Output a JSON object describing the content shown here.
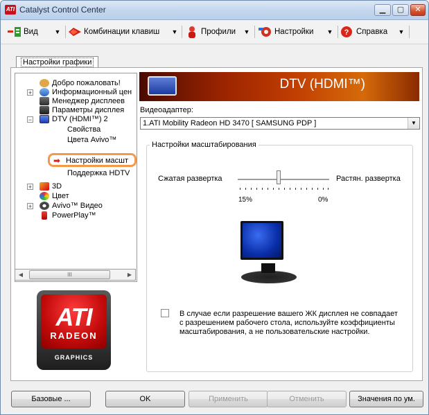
{
  "window": {
    "title": "Catalyst Control Center",
    "icon_text": "ATI"
  },
  "toolbar": {
    "view_label": "Вид",
    "hotkeys_label": "Комбинации клавиш",
    "profiles_label": "Профили",
    "settings_label": "Настройки",
    "help_label": "Справка"
  },
  "tab": {
    "label": "Настройки графики"
  },
  "tree": {
    "items": [
      {
        "label": "Добро пожаловать!"
      },
      {
        "label": "Информационный цен"
      },
      {
        "label": "Менеджер дисплеев"
      },
      {
        "label": "Параметры дисплея"
      },
      {
        "label": "DTV (HDMI™) 2"
      },
      {
        "label": "Свойства"
      },
      {
        "label": "Цвета Avivo™"
      },
      {
        "label": "Настройки масшт"
      },
      {
        "label": "Поддержка HDTV"
      },
      {
        "label": "3D"
      },
      {
        "label": "Цвет"
      },
      {
        "label": "Avivo™ Видео"
      },
      {
        "label": "PowerPlay™"
      }
    ],
    "scroll_thumb": "III"
  },
  "logo": {
    "brand": "ATI",
    "line1": "RADEON",
    "line2": "GRAPHICS"
  },
  "panel": {
    "banner_title": "DTV (HDMI™)",
    "adapter_label": "Видеоадаптер:",
    "adapter_value": "1.ATI Mobility Radeon HD 3470  [ SAMSUNG PDP ]",
    "group_title": "Настройки масштабирования",
    "slider_left": "Сжатая развертка",
    "slider_right": "Растян. развертка",
    "tick_left": "15%",
    "tick_right": "0%",
    "slider_value_percent": 15,
    "checkbox_checked": false,
    "checkbox_text": "В случае если разрешение вашего ЖК дисплея не совпадает с разрешением рабочего стола, используйте коэффициенты масштабирования, а не пользовательские настройки."
  },
  "buttons": {
    "basic": "Базовые ...",
    "ok": "OK",
    "apply": "Применить",
    "cancel": "Отменить",
    "defaults": "Значения по ум."
  }
}
